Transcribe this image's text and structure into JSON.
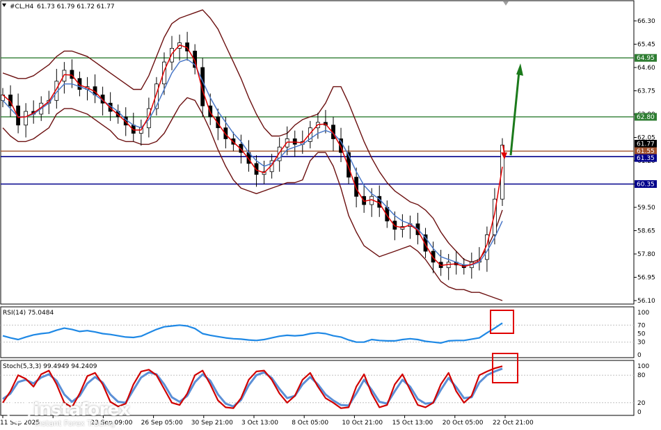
{
  "header": {
    "symbol_label": "#CL,H4",
    "ohlc": "61.73 61.79 61.72 61.77",
    "rsi_label": "RSI(14) 75.0484",
    "stoch_label": "Stoch(5,3,3) 99.4949 94.2409"
  },
  "colors": {
    "candles": "#000000",
    "bollinger": "#6b0f0f",
    "ma_fast": "#e00000",
    "ma_slow": "#4a78c8",
    "level_green": "#2e7d32",
    "level_blue": "#00008b",
    "level_brown": "#a0522d",
    "arrow_green": "#1b7a1b",
    "arrow_red": "#e00000",
    "rsi_line": "#1e88e5",
    "stoch_main": "#d00000",
    "stoch_signal": "#5b8fd6",
    "highlight_box": "#e00000"
  },
  "price_axis": {
    "ticks": [
      "66.30",
      "65.45",
      "64.60",
      "63.75",
      "62.90",
      "62.05",
      "61.20",
      "60.35",
      "59.50",
      "58.65",
      "57.80",
      "56.95",
      "56.10"
    ]
  },
  "level_tags": [
    {
      "text": "64.95",
      "color": "green"
    },
    {
      "text": "62.80",
      "color": "green"
    },
    {
      "text": "61.77",
      "color": "black"
    },
    {
      "text": "61.55",
      "color": "brown"
    },
    {
      "text": "61.35",
      "color": "blue"
    },
    {
      "text": "60.35",
      "color": "blue"
    }
  ],
  "time_axis": {
    "labels": [
      "11 Sep 2025",
      "",
      "23 Sep 09:00",
      "26 Sep 05:00",
      "30 Sep 21:00",
      "3 Oct 13:00",
      "8 Oct 05:00",
      "10 Oct 21:00",
      "15 Oct 13:00",
      "20 Oct 05:00",
      "22 Oct 21:00"
    ]
  },
  "rsi_axis": {
    "ticks": [
      "100",
      "70",
      "50",
      "30",
      "0"
    ]
  },
  "stoch_axis": {
    "ticks": [
      "100",
      "80",
      "20",
      "0"
    ]
  },
  "watermark": {
    "brand": "instaforex",
    "tagline": "Instant Forex Trading"
  },
  "chart_data": [
    {
      "type": "line",
      "title": "#CL,H4",
      "ylim": [
        56.1,
        66.3
      ],
      "grid": false,
      "x_labels": [
        "11 Sep 2025",
        "23 Sep 09:00",
        "26 Sep 05:00",
        "30 Sep 21:00",
        "3 Oct 13:00",
        "8 Oct 05:00",
        "10 Oct 21:00",
        "15 Oct 13:00",
        "20 Oct 05:00",
        "22 Oct 21:00"
      ],
      "series": [
        {
          "values": [
            63.6,
            63.2,
            62.5,
            63.0,
            62.9,
            63.3,
            63.4,
            64.1,
            64.5,
            64.2,
            63.8,
            63.9,
            63.6,
            63.3,
            63.0,
            62.8,
            62.5,
            62.2,
            62.4,
            63.1,
            64.0,
            64.8,
            65.3,
            65.5,
            65.2,
            64.6,
            63.2,
            62.8,
            62.4,
            62.0,
            61.8,
            61.5,
            61.1,
            60.7,
            60.8,
            61.2,
            61.7,
            62.0,
            61.8,
            61.9,
            62.4,
            62.6,
            62.5,
            62.0,
            61.5,
            60.6,
            59.9,
            59.6,
            59.9,
            59.5,
            59.0,
            58.7,
            58.8,
            58.9,
            58.5,
            57.9,
            57.5,
            57.3,
            57.5,
            57.4,
            57.3,
            57.5,
            57.6,
            58.5,
            59.8,
            61.77
          ]
        },
        {
          "values": [
            63.4,
            63.1,
            62.8,
            62.8,
            62.9,
            63.1,
            63.3,
            63.7,
            64.0,
            64.0,
            63.9,
            63.8,
            63.6,
            63.4,
            63.2,
            63.0,
            62.7,
            62.5,
            62.4,
            62.7,
            63.2,
            63.8,
            64.4,
            64.8,
            64.9,
            64.7,
            64.1,
            63.5,
            63.0,
            62.6,
            62.2,
            61.9,
            61.5,
            61.2,
            61.0,
            61.1,
            61.3,
            61.6,
            61.7,
            61.8,
            62.0,
            62.2,
            62.3,
            62.2,
            61.9,
            61.4,
            60.8,
            60.3,
            60.0,
            59.8,
            59.5,
            59.2,
            59.0,
            58.9,
            58.7,
            58.4,
            58.0,
            57.7,
            57.6,
            57.5,
            57.4,
            57.4,
            57.5,
            57.9,
            58.4,
            59.0
          ]
        },
        {
          "values": [
            64.4,
            64.3,
            64.2,
            64.2,
            64.3,
            64.5,
            64.7,
            65.0,
            65.2,
            65.2,
            65.1,
            65.0,
            64.8,
            64.6,
            64.4,
            64.2,
            64.0,
            63.8,
            63.8,
            64.3,
            65.0,
            65.7,
            66.2,
            66.4,
            66.5,
            66.6,
            66.7,
            66.4,
            66.0,
            65.4,
            64.8,
            64.2,
            63.5,
            62.9,
            62.4,
            62.1,
            62.1,
            62.2,
            62.5,
            62.7,
            62.8,
            62.9,
            63.3,
            63.9,
            63.9,
            63.3,
            62.6,
            61.9,
            61.3,
            60.8,
            60.4,
            60.1,
            59.9,
            59.7,
            59.6,
            59.4,
            59.1,
            58.6,
            58.2,
            57.9,
            57.6,
            57.5,
            57.6,
            58.0,
            58.6,
            59.4
          ]
        },
        {
          "values": [
            62.4,
            62.1,
            61.9,
            61.9,
            62.0,
            62.2,
            62.4,
            62.9,
            63.1,
            63.1,
            63.0,
            62.9,
            62.7,
            62.5,
            62.3,
            62.0,
            61.9,
            61.9,
            61.8,
            61.8,
            61.9,
            62.2,
            62.7,
            63.2,
            63.5,
            63.4,
            62.9,
            62.3,
            61.6,
            61.0,
            60.5,
            60.2,
            60.1,
            60.0,
            60.1,
            60.2,
            60.3,
            60.4,
            60.4,
            60.5,
            61.2,
            61.5,
            61.5,
            61.0,
            60.2,
            59.2,
            58.6,
            58.1,
            57.9,
            57.7,
            57.8,
            57.9,
            58.0,
            58.1,
            57.9,
            57.6,
            57.2,
            56.8,
            56.6,
            56.5,
            56.5,
            56.4,
            56.4,
            56.3,
            56.2,
            56.1
          ]
        }
      ]
    },
    {
      "type": "line",
      "title": "RSI(14) 75.0484",
      "ylim": [
        0,
        100
      ],
      "series": [
        {
          "values": [
            45,
            40,
            36,
            42,
            47,
            50,
            52,
            58,
            63,
            60,
            55,
            57,
            54,
            50,
            48,
            45,
            42,
            41,
            44,
            52,
            60,
            66,
            68,
            70,
            68,
            62,
            50,
            46,
            43,
            40,
            38,
            37,
            35,
            34,
            36,
            40,
            44,
            46,
            45,
            46,
            50,
            52,
            50,
            45,
            42,
            35,
            30,
            30,
            36,
            34,
            33,
            33,
            36,
            38,
            36,
            32,
            30,
            28,
            33,
            34,
            34,
            37,
            40,
            52,
            63,
            75
          ]
        }
      ]
    },
    {
      "type": "line",
      "title": "Stoch(5,3,3) 99.4949 94.2409",
      "ylim": [
        0,
        100
      ],
      "series": [
        {
          "values": [
            20,
            45,
            80,
            72,
            55,
            82,
            90,
            60,
            20,
            10,
            40,
            78,
            85,
            60,
            22,
            12,
            18,
            60,
            88,
            92,
            80,
            50,
            20,
            15,
            40,
            80,
            90,
            60,
            25,
            10,
            8,
            30,
            70,
            88,
            90,
            70,
            40,
            20,
            35,
            70,
            85,
            55,
            30,
            20,
            8,
            10,
            55,
            82,
            40,
            10,
            15,
            60,
            82,
            48,
            15,
            10,
            20,
            60,
            85,
            45,
            20,
            35,
            80,
            88,
            95,
            99.5
          ]
        },
        {
          "values": [
            28,
            40,
            65,
            70,
            62,
            75,
            82,
            68,
            38,
            22,
            35,
            62,
            76,
            64,
            38,
            22,
            20,
            48,
            75,
            86,
            82,
            60,
            32,
            22,
            35,
            65,
            82,
            68,
            38,
            18,
            12,
            26,
            58,
            80,
            86,
            74,
            50,
            30,
            35,
            60,
            76,
            60,
            38,
            25,
            15,
            14,
            40,
            70,
            48,
            22,
            18,
            45,
            70,
            55,
            28,
            18,
            20,
            48,
            74,
            54,
            30,
            32,
            64,
            80,
            88,
            94.2
          ]
        }
      ]
    }
  ]
}
